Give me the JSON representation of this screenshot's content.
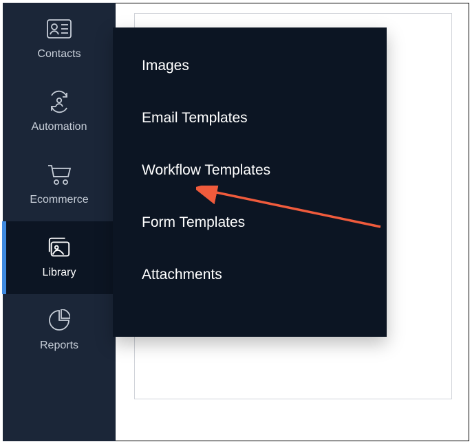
{
  "sidebar": {
    "items": [
      {
        "id": "contacts",
        "label": "Contacts"
      },
      {
        "id": "automation",
        "label": "Automation"
      },
      {
        "id": "ecommerce",
        "label": "Ecommerce"
      },
      {
        "id": "library",
        "label": "Library",
        "active": true
      },
      {
        "id": "reports",
        "label": "Reports"
      }
    ]
  },
  "library_flyout": {
    "items": [
      {
        "id": "images",
        "label": "Images"
      },
      {
        "id": "email-templates",
        "label": "Email Templates"
      },
      {
        "id": "workflow-templates",
        "label": "Workflow Templates"
      },
      {
        "id": "form-templates",
        "label": "Form Templates"
      },
      {
        "id": "attachments",
        "label": "Attachments"
      }
    ]
  },
  "annotation": {
    "arrow_target": "workflow-templates",
    "arrow_color": "#f05b3c"
  }
}
